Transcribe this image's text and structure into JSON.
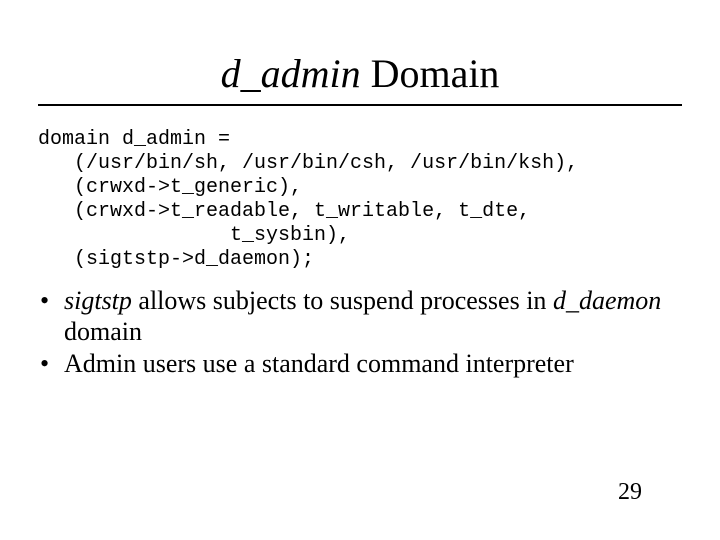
{
  "title": {
    "italic": "d_admin",
    "rest": " Domain"
  },
  "code": {
    "l1": "domain d_admin =",
    "l2": "   (/usr/bin/sh, /usr/bin/csh, /usr/bin/ksh),",
    "l3": "   (crwxd->t_generic),",
    "l4": "   (crwxd->t_readable, t_writable, t_dte,",
    "l5": "                t_sysbin),",
    "l6": "   (sigtstp->d_daemon);"
  },
  "bullets": [
    {
      "pre_italic": "sigtstp",
      "mid": " allows subjects to suspend processes in ",
      "post_italic": "d_daemon",
      "tail": " domain"
    },
    {
      "plain": "Admin users use a standard command interpreter"
    }
  ],
  "page_number": "29",
  "bullet_char": "•"
}
